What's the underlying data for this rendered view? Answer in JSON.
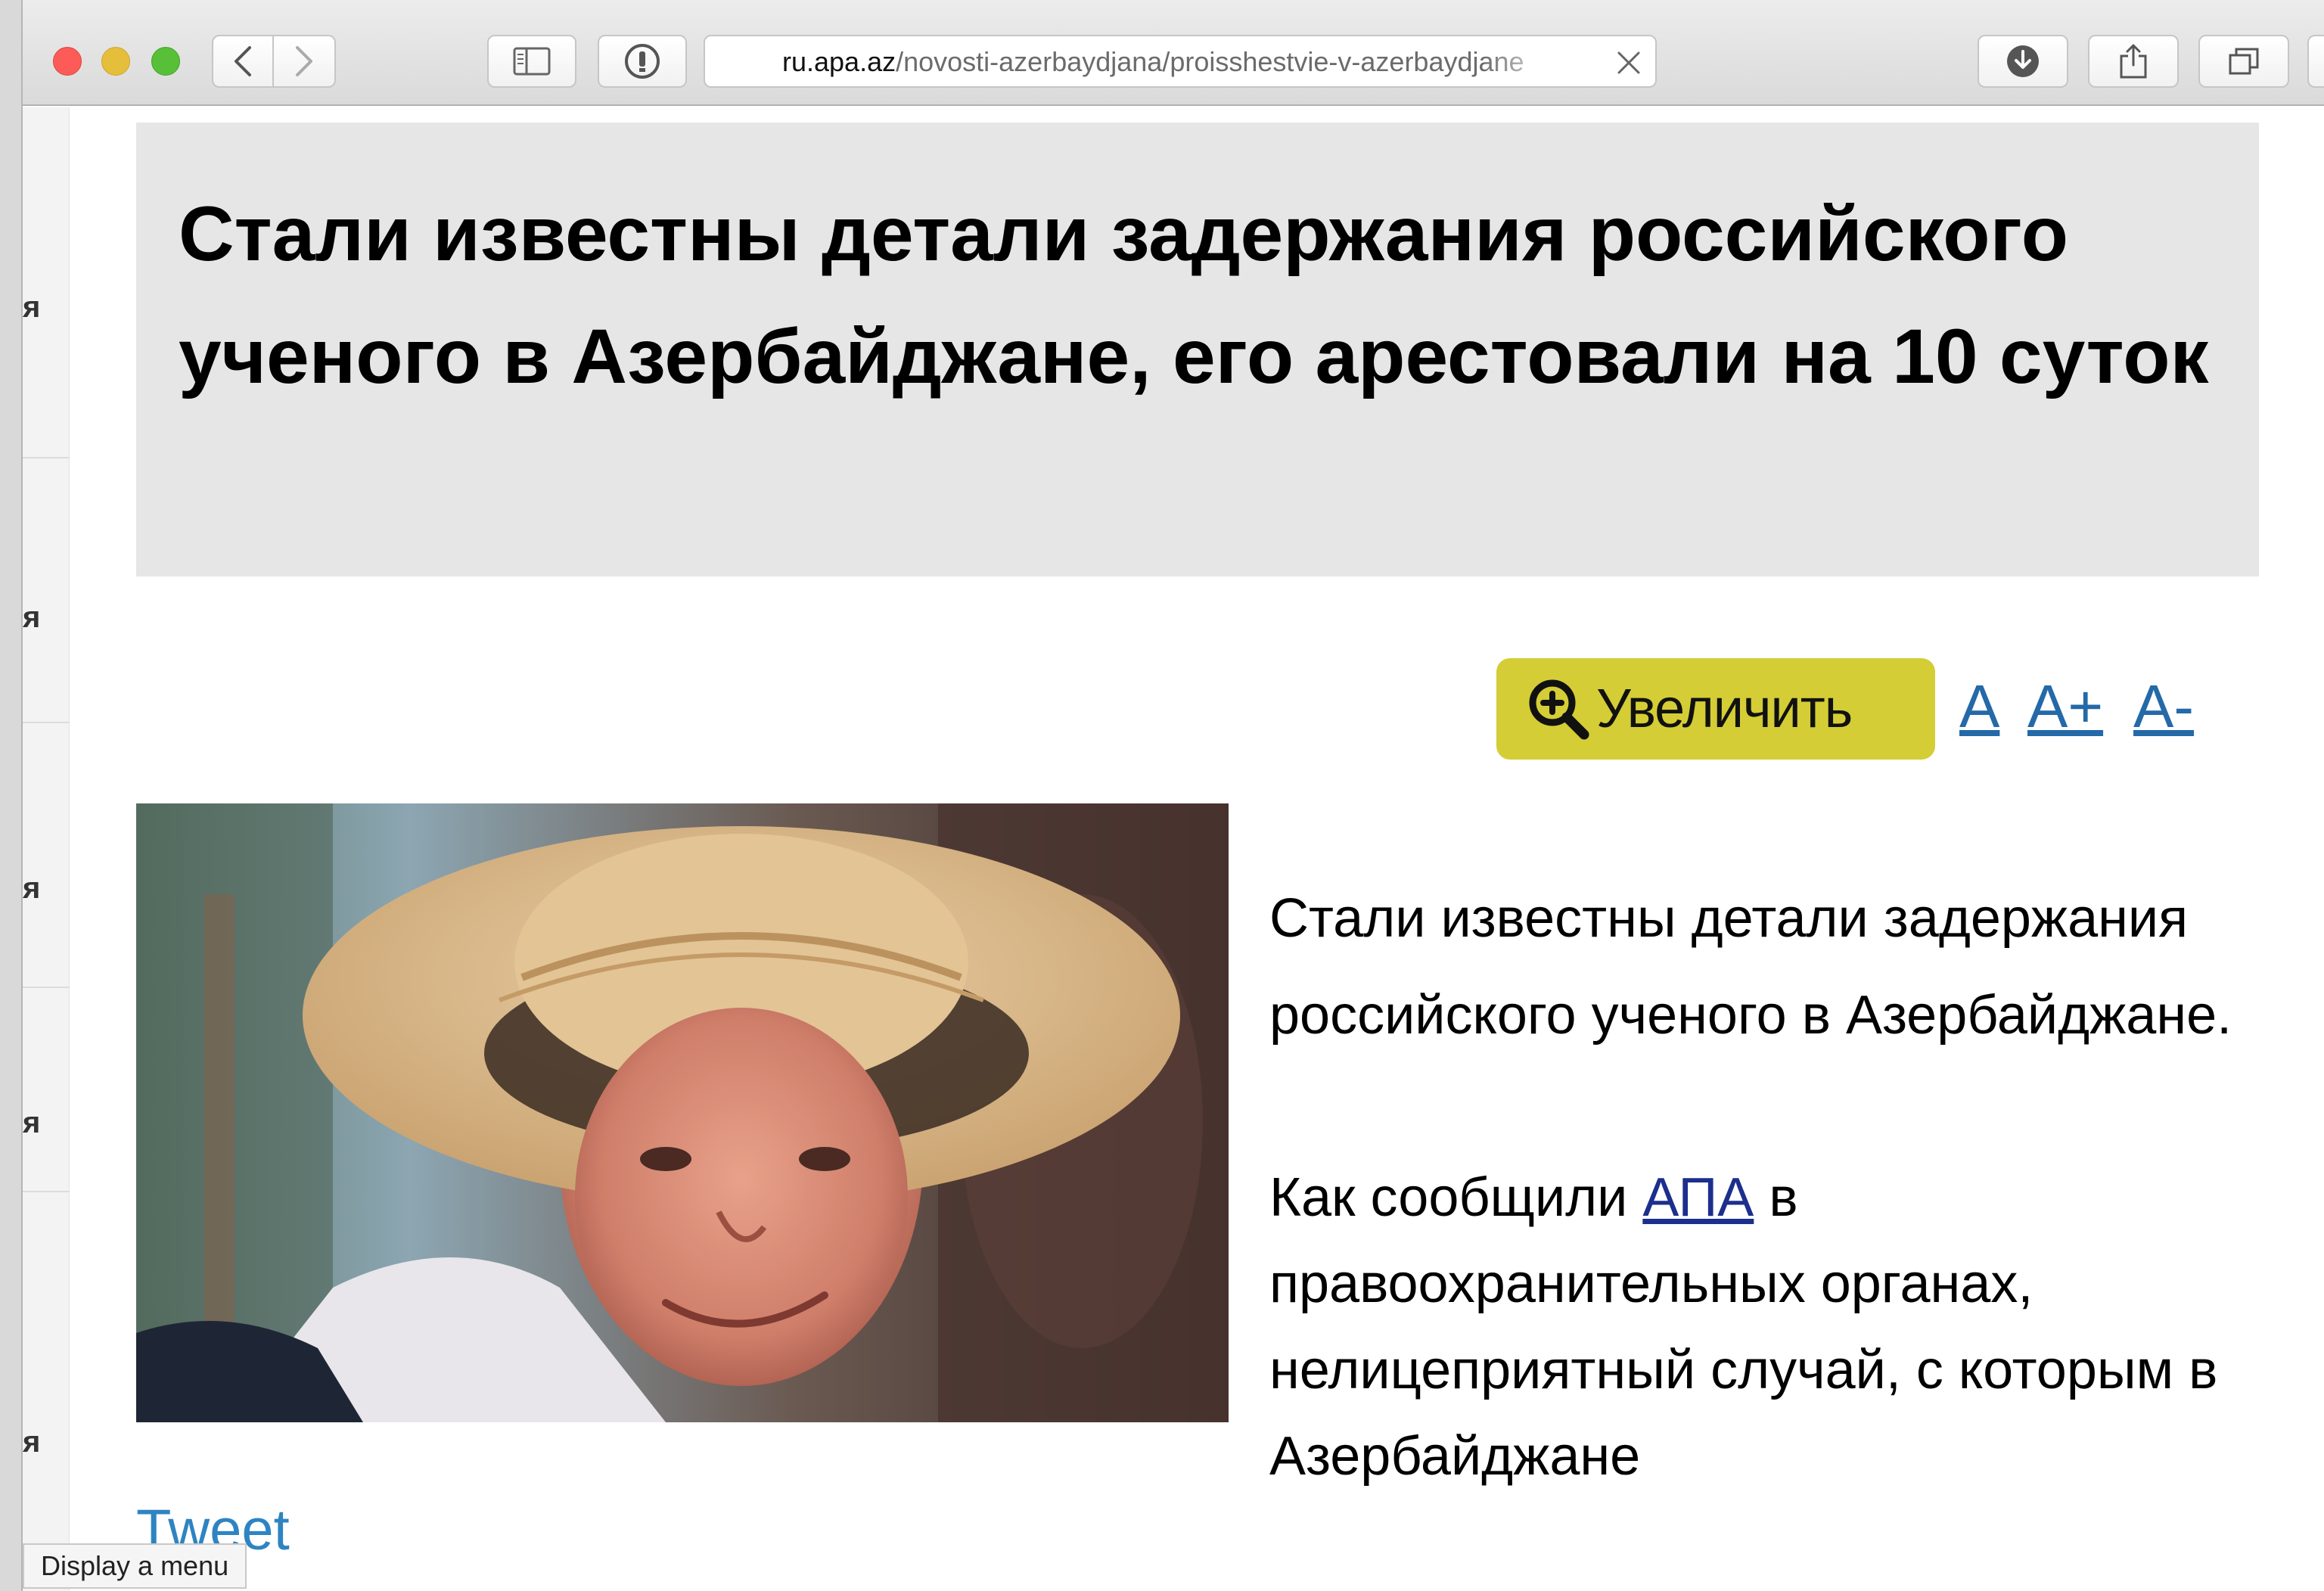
{
  "browser": {
    "url_domain": "ru.apa.az",
    "url_path": "/novosti-azerbaydjana/proisshestvie-v-azerbaydjane",
    "icons": {
      "back": "chevron-left-icon",
      "forward": "chevron-right-icon",
      "sidebar": "sidebar-icon",
      "privacy": "privacy-report-icon",
      "clear": "close-icon",
      "downloads": "download-icon",
      "share": "share-icon",
      "tabs": "tabs-overview-icon"
    }
  },
  "left_menu": {
    "glyphs": [
      "я",
      "я",
      "я",
      "я",
      "я"
    ]
  },
  "article": {
    "headline": "Стали известны детали задержания российского ученого в Азербайджане, его арестовали на 10 суток",
    "zoom_button_label": "Увеличить",
    "font_controls": {
      "normal": "A",
      "bigger": "A+",
      "smaller": "A-"
    },
    "paragraph1": "Стали известны детали задержания российского ученого в Азербайджане.",
    "paragraph2_before_link": "Как сообщили ",
    "paragraph2_link": "АПА",
    "paragraph2_after_link": " в правоохранительных органах, нелицеприятный случай, с которым в Азербайджане",
    "tweet_label": "Tweet"
  },
  "tooltip": "Display a menu",
  "colors": {
    "zoom_button": "#d4cd35",
    "link": "#2469a8",
    "headline_bg": "#e6e6e6"
  }
}
